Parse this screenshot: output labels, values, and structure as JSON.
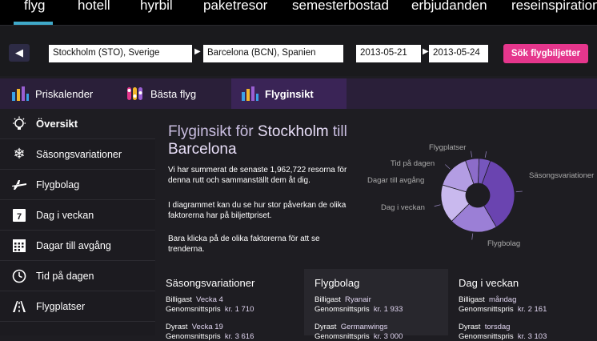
{
  "topnav": {
    "items": [
      "flyg",
      "hotell",
      "hyrbil",
      "paketresor",
      "semesterbostad",
      "erbjudanden",
      "reseinspiration"
    ]
  },
  "search": {
    "origin": "Stockholm (STO), Sverige",
    "destination": "Barcelona (BCN), Spanien",
    "depart_date": "2013-05-21",
    "return_date": "2013-05-24",
    "button_label": "Sök flygbiljetter"
  },
  "tabs": [
    {
      "label": "Priskalender",
      "icon": "bar-chart-icon"
    },
    {
      "label": "Bästa flyg",
      "icon": "rating-icon"
    },
    {
      "label": "Flyginsikt",
      "icon": "bar-chart-icon",
      "active": true
    }
  ],
  "sidebar": {
    "items": [
      {
        "label": "Översikt",
        "icon": "lightbulb-icon",
        "active": true
      },
      {
        "label": "Säsongsvariationer",
        "icon": "snowflake-icon"
      },
      {
        "label": "Flygbolag",
        "icon": "airplane-icon"
      },
      {
        "label": "Dag i veckan",
        "icon": "calendar-day-icon"
      },
      {
        "label": "Dagar till avgång",
        "icon": "calendar-grid-icon"
      },
      {
        "label": "Tid på dagen",
        "icon": "clock-icon"
      },
      {
        "label": "Flygplatser",
        "icon": "runway-icon"
      }
    ]
  },
  "main": {
    "title_prefix": "Flyginsikt för ",
    "title_origin": "Stockholm",
    "title_mid": " till",
    "title_destination": "Barcelona",
    "para1": "Vi har summerat de senaste 1,962,722 resorna för denna rutt och sammanställt dem åt dig.",
    "para2": "I diagrammet kan du se hur stor påverkan de olika faktorerna har på biljettpriset.",
    "para3": "Bara klicka på de olika faktorerna för att se trenderna."
  },
  "chart_data": {
    "type": "pie",
    "categories": [
      "Säsongsvariationer",
      "Flygbolag",
      "Dag i veckan",
      "Dagar till avgång",
      "Tid på dagen",
      "Flygplatser"
    ],
    "values": [
      36,
      21,
      17,
      15,
      6,
      5
    ],
    "colors": [
      "#6a44b0",
      "#9b7fd6",
      "#c9b9ee",
      "#b39de3",
      "#8c6cc9",
      "#7656bd"
    ]
  },
  "cards": [
    {
      "heading": "Säsongsvariationer",
      "cheapest_label": "Billigast",
      "cheapest_value": "Vecka 4",
      "avg_label": "Genomsnittspris",
      "avg_value": "kr. 1 710",
      "expensive_label": "Dyrast",
      "expensive_value": "Vecka 19",
      "avg2_value": "kr. 3 616"
    },
    {
      "heading": "Flygbolag",
      "cheapest_label": "Billigast",
      "cheapest_value": "Ryanair",
      "avg_label": "Genomsnittspris",
      "avg_value": "kr. 1 933",
      "expensive_label": "Dyrast",
      "expensive_value": "Germanwings",
      "avg2_value": "kr. 3 000"
    },
    {
      "heading": "Dag i veckan",
      "cheapest_label": "Billigast",
      "cheapest_value": "måndag",
      "avg_label": "Genomsnittspris",
      "avg_value": "kr. 2 161",
      "expensive_label": "Dyrast",
      "expensive_value": "torsdag",
      "avg2_value": "kr. 3 103"
    }
  ]
}
